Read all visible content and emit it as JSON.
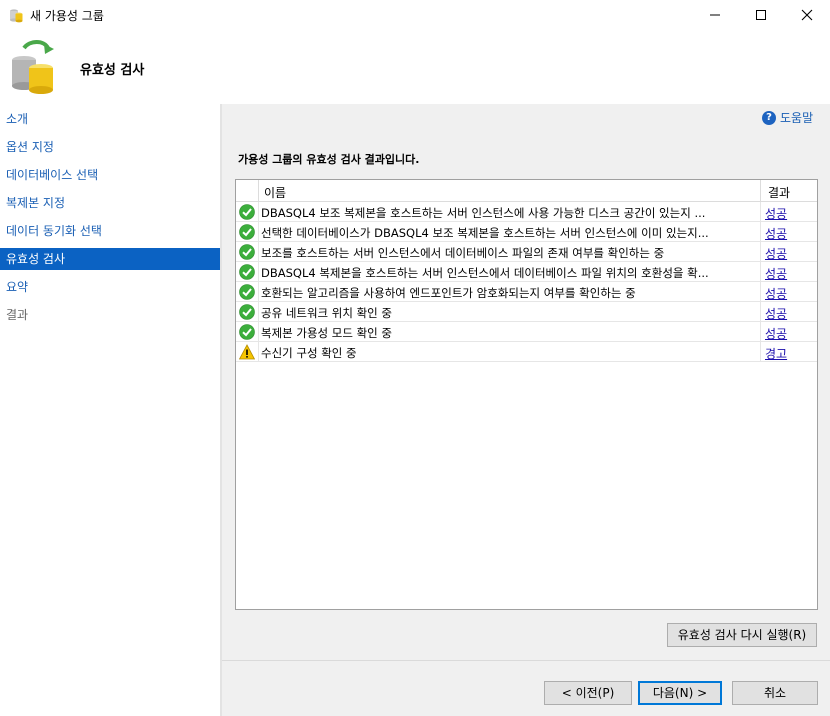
{
  "window": {
    "title": "새 가용성 그룹"
  },
  "header": {
    "title": "유효성 검사"
  },
  "nav": {
    "items": [
      {
        "label": "소개",
        "state": "link"
      },
      {
        "label": "옵션 지정",
        "state": "link"
      },
      {
        "label": "데이터베이스 선택",
        "state": "link"
      },
      {
        "label": "복제본 지정",
        "state": "link"
      },
      {
        "label": "데이터 동기화 선택",
        "state": "link"
      },
      {
        "label": "유효성 검사",
        "state": "active"
      },
      {
        "label": "요약",
        "state": "link"
      },
      {
        "label": "결과",
        "state": "disabled"
      }
    ]
  },
  "help": {
    "label": "도움말",
    "icon": "help-icon"
  },
  "main": {
    "caption": "가용성 그룹의 유효성 검사 결과입니다.",
    "grid": {
      "columns": {
        "name": "이름",
        "result": "결과"
      },
      "rows": [
        {
          "status": "success",
          "name": "DBASQL4 보조 복제본을 호스트하는 서버 인스턴스에 사용 가능한 디스크 공간이 있는지 ...",
          "result": "성공"
        },
        {
          "status": "success",
          "name": "선택한 데이터베이스가 DBASQL4 보조 복제본을 호스트하는 서버 인스턴스에 이미 있는지...",
          "result": "성공"
        },
        {
          "status": "success",
          "name": "보조를 호스트하는 서버 인스턴스에서 데이터베이스 파일의 존재 여부를 확인하는 중",
          "result": "성공"
        },
        {
          "status": "success",
          "name": "DBASQL4 복제본을 호스트하는 서버 인스턴스에서 데이터베이스 파일 위치의 호환성을 확...",
          "result": "성공"
        },
        {
          "status": "success",
          "name": "호환되는 알고리즘을 사용하여 엔드포인트가 암호화되는지 여부를 확인하는 중",
          "result": "성공"
        },
        {
          "status": "success",
          "name": "공유 네트워크 위치 확인 중",
          "result": "성공"
        },
        {
          "status": "success",
          "name": "복제본 가용성 모드 확인 중",
          "result": "성공"
        },
        {
          "status": "warning",
          "name": "수신기 구성 확인 중",
          "result": "경고"
        }
      ]
    },
    "rerun_label": "유효성 검사 다시 실행(R)"
  },
  "footer": {
    "prev_label": "< 이전(P)",
    "next_label": "다음(N) >",
    "cancel_label": "취소"
  },
  "colors": {
    "accent": "#0b62c3",
    "link": "#1a0dab",
    "success": "#3cae3c",
    "warning": "#f5c400"
  }
}
